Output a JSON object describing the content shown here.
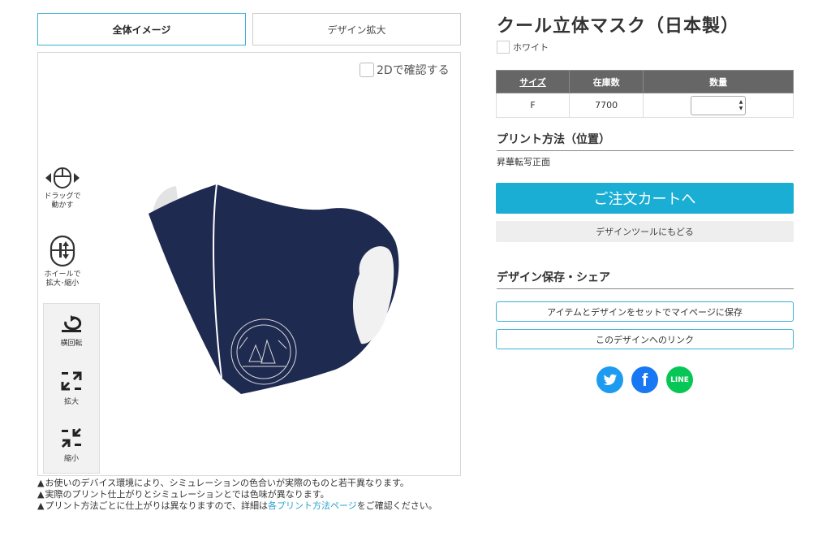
{
  "tabs": {
    "overview": "全体イメージ",
    "zoom": "デザイン拡大"
  },
  "preview": {
    "view2d_label": "2Dで確認する",
    "hint_drag": "ドラッグで\n動かす",
    "hint_wheel": "ホイールで\n拡大･縮小",
    "tool_rotate": "横回転",
    "tool_zoom_in": "拡大",
    "tool_zoom_out": "縮小"
  },
  "notes": {
    "line1": "お使いのデバイス環境により、シミュレーションの色合いが実際のものと若干異なります。",
    "line2": "実際のプリント仕上がりとシミュレーションとでは色味が異なります。",
    "line3_a": "プリント方法ごとに仕上がりは異なりますので、詳細は",
    "line3_link": "各プリント方法ページ",
    "line3_b": "をご確認ください。"
  },
  "product": {
    "title": "クール立体マスク（日本製）",
    "color_name": "ホワイト",
    "mask_color": "#1f2a50"
  },
  "stock_table": {
    "headers": [
      "サイズ",
      "在庫数",
      "数量"
    ],
    "rows": [
      {
        "size": "F",
        "stock": "7700",
        "qty": ""
      }
    ]
  },
  "print_method": {
    "heading": "プリント方法（位置）",
    "value": "昇華転写正面"
  },
  "buttons": {
    "cart": "ご注文カートへ",
    "back_to_tool": "デザインツールにもどる",
    "save_mypage": "アイテムとデザインをセットでマイページに保存",
    "design_link": "このデザインへのリンク"
  },
  "share": {
    "heading": "デザイン保存・シェア",
    "twitter_color": "#1d9bf0",
    "facebook_color": "#1877f2",
    "line_color": "#06c755",
    "line_label": "LINE"
  }
}
